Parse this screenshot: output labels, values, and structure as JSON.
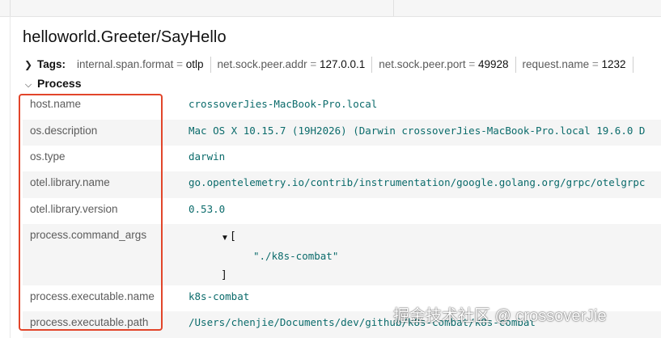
{
  "span": {
    "title": "helloworld.Greeter/SayHello"
  },
  "tags": {
    "label": "Tags:",
    "items": [
      {
        "key": "internal.span.format",
        "value": "otlp"
      },
      {
        "key": "net.sock.peer.addr",
        "value": "127.0.0.1"
      },
      {
        "key": "net.sock.peer.port",
        "value": "49928"
      },
      {
        "key": "request.name",
        "value": "1232"
      }
    ]
  },
  "process": {
    "label": "Process",
    "rows": [
      {
        "key": "host.name",
        "value": "crossoverJies-MacBook-Pro.local"
      },
      {
        "key": "os.description",
        "value": "Mac OS X 10.15.7 (19H2026) (Darwin crossoverJies-MacBook-Pro.local 19.6.0 D"
      },
      {
        "key": "os.type",
        "value": "darwin"
      },
      {
        "key": "otel.library.name",
        "value": "go.opentelemetry.io/contrib/instrumentation/google.golang.org/grpc/otelgrpc"
      },
      {
        "key": "otel.library.version",
        "value": "0.53.0"
      },
      {
        "key": "process.command_args",
        "json_open": "[",
        "json_item": "\"./k8s-combat\"",
        "json_close": "]"
      },
      {
        "key": "process.executable.name",
        "value": "k8s-combat"
      },
      {
        "key": "process.executable.path",
        "value": "/Users/chenjie/Documents/dev/github/k8s-combat/k8s-combat"
      }
    ]
  },
  "watermark": "掘金技术社区 @ crossoverJie",
  "colors": {
    "highlight": "#e2452a",
    "value_text": "#0b6b6b",
    "row_stripe": "#f5f5f5"
  }
}
